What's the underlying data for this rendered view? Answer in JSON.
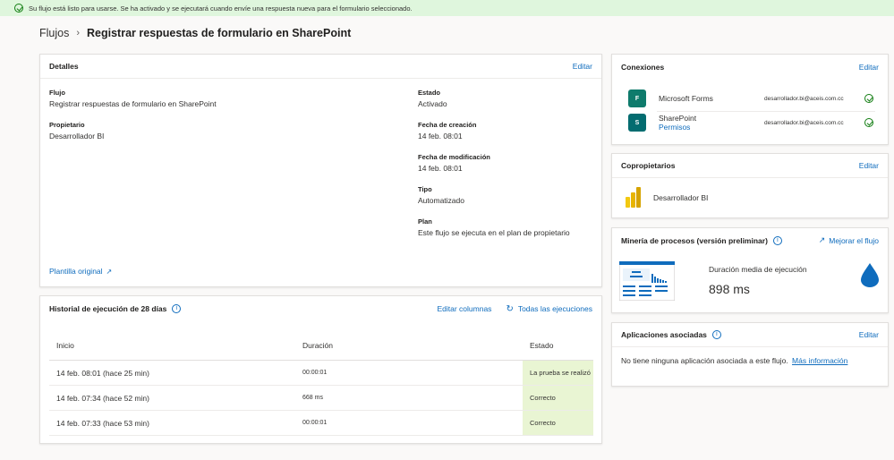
{
  "banner": {
    "text": "Su flujo está listo para usarse. Se ha activado y se ejecutará cuando envíe una respuesta nueva para el formulario seleccionado."
  },
  "breadcrumb": {
    "root": "Flujos",
    "current": "Registrar respuestas de formulario en SharePoint"
  },
  "details": {
    "title": "Detalles",
    "edit": "Editar",
    "flow_label": "Flujo",
    "flow_value": "Registrar respuestas de formulario en SharePoint",
    "owner_label": "Propietario",
    "owner_value": "Desarrollador BI",
    "state_label": "Estado",
    "state_value": "Activado",
    "created_label": "Fecha de creación",
    "created_value": "14 feb. 08:01",
    "modified_label": "Fecha de modificación",
    "modified_value": "14 feb. 08:01",
    "type_label": "Tipo",
    "type_value": "Automatizado",
    "plan_label": "Plan",
    "plan_value": "Este flujo se ejecuta en el plan de propietario",
    "template_link": "Plantilla original"
  },
  "history": {
    "title": "Historial de ejecución de 28 días",
    "edit_columns": "Editar columnas",
    "all_runs": "Todas las ejecuciones",
    "columns": [
      "Inicio",
      "Duración",
      "Estado"
    ],
    "rows": [
      {
        "start": "14 feb. 08:01 (hace 25 min)",
        "duration": "00:00:01",
        "status": "La prueba se realizó"
      },
      {
        "start": "14 feb. 07:34 (hace 52 min)",
        "duration": "668 ms",
        "status": "Correcto"
      },
      {
        "start": "14 feb. 07:33 (hace 53 min)",
        "duration": "00:00:01",
        "status": "Correcto"
      }
    ]
  },
  "connections": {
    "title": "Conexiones",
    "edit": "Editar",
    "items": [
      {
        "name": "Microsoft Forms",
        "account": "desarrollador.bi@aceis.com.cc"
      },
      {
        "name": "SharePoint",
        "sub": "Permisos",
        "account": "desarrollador.bi@aceis.com.cc"
      }
    ]
  },
  "coowners": {
    "title": "Copropietarios",
    "edit": "Editar",
    "name": "Desarrollador BI"
  },
  "mining": {
    "title": "Minería de procesos (versión preliminar)",
    "improve": "Mejorar el flujo",
    "metric_label": "Duración media de ejecución",
    "metric_value": "898 ms"
  },
  "apps": {
    "title": "Aplicaciones asociadas",
    "edit": "Editar",
    "empty_text": "No tiene ninguna aplicación asociada a este flujo.",
    "more_link": "Más información"
  }
}
